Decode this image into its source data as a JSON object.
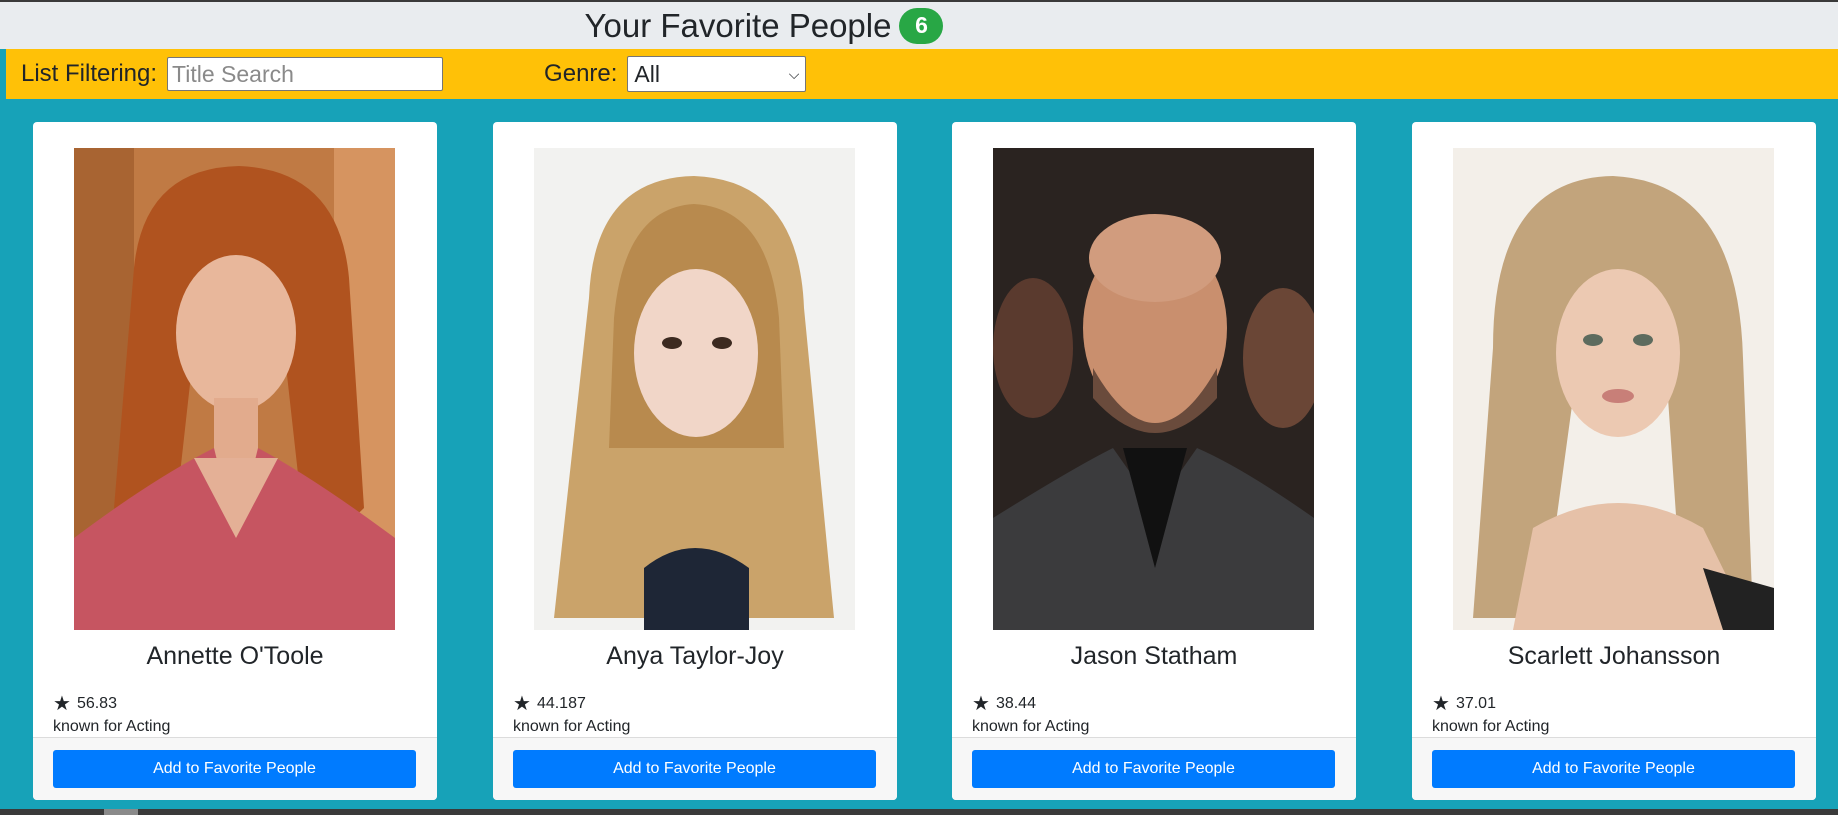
{
  "header": {
    "title": "Your Favorite People",
    "count": "6"
  },
  "filters": {
    "list_label": "List Filtering:",
    "search_placeholder": "Title Search",
    "genre_label": "Genre:",
    "genre_selected": "All"
  },
  "people": [
    {
      "name": "Annette O'Toole",
      "rating": "56.83",
      "known_for": "known for Acting",
      "button_label": "Add to Favorite People"
    },
    {
      "name": "Anya Taylor-Joy",
      "rating": "44.187",
      "known_for": "known for Acting",
      "button_label": "Add to Favorite People"
    },
    {
      "name": "Jason Statham",
      "rating": "38.44",
      "known_for": "known for Acting",
      "button_label": "Add to Favorite People"
    },
    {
      "name": "Scarlett Johansson",
      "rating": "37.01",
      "known_for": "known for Acting",
      "button_label": "Add to Favorite People"
    }
  ],
  "icons": {
    "rating": "star-icon",
    "select": "chevron-down-icon"
  },
  "colors": {
    "background": "#17a2b8",
    "header": "#e9ecef",
    "filterbar": "#ffc107",
    "badge": "#28a745",
    "button": "#007bff"
  }
}
